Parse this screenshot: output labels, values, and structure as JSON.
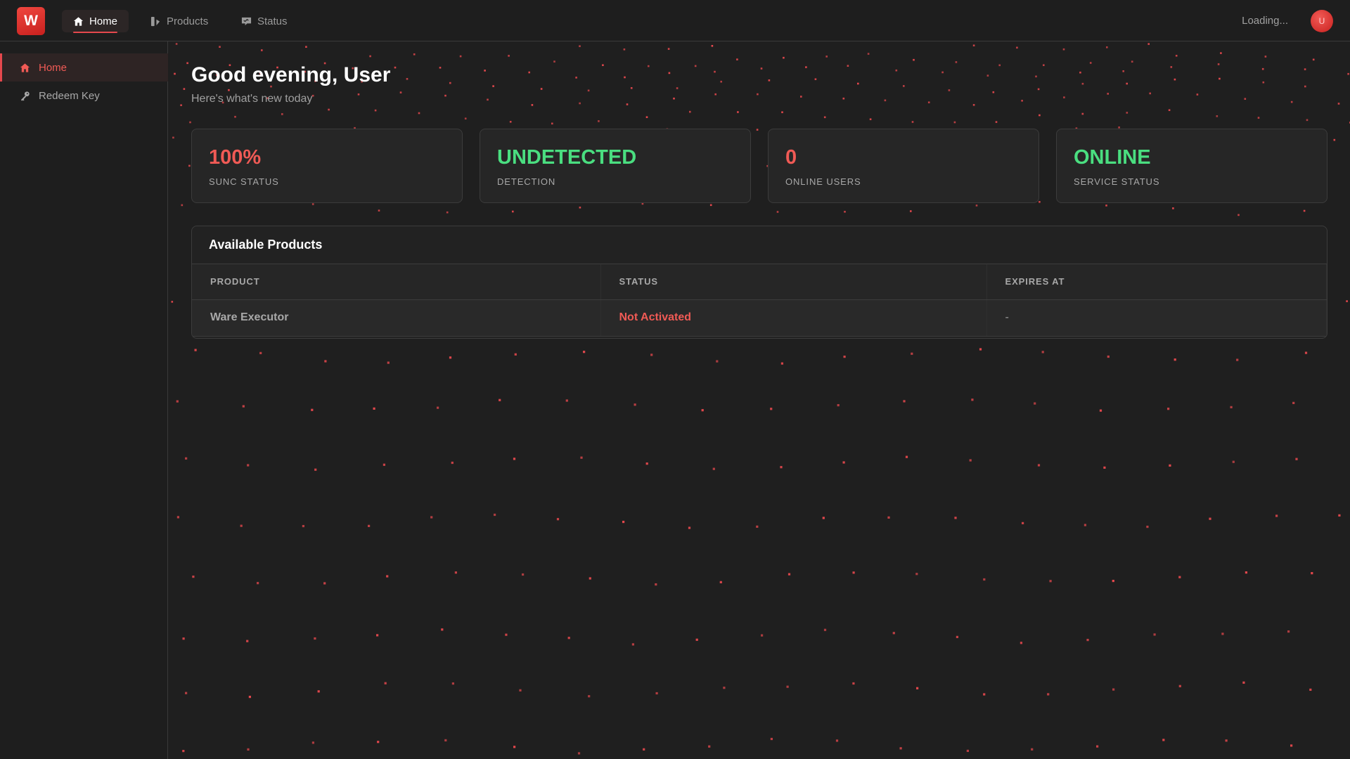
{
  "app": {
    "logo_letter": "W"
  },
  "topnav": {
    "tabs": [
      {
        "label": "Home",
        "icon": "home-icon",
        "active": true
      },
      {
        "label": "Products",
        "icon": "products-icon",
        "active": false
      },
      {
        "label": "Status",
        "icon": "status-icon",
        "active": false
      }
    ],
    "loading_text": "Loading...",
    "avatar_initial": "U"
  },
  "sidebar": {
    "items": [
      {
        "label": "Home",
        "icon": "home-icon",
        "active": true
      },
      {
        "label": "Redeem Key",
        "icon": "key-icon",
        "active": false
      }
    ]
  },
  "main": {
    "greeting": "Good evening, User",
    "subtitle": "Here's what's new today",
    "stats": [
      {
        "value": "100%",
        "label": "SUNC STATUS",
        "color": "#f05a55"
      },
      {
        "value": "UNDETECTED",
        "label": "DETECTION",
        "color": "#4ade80"
      },
      {
        "value": "0",
        "label": "ONLINE USERS",
        "color": "#f05a55"
      },
      {
        "value": "ONLINE",
        "label": "SERVICE STATUS",
        "color": "#4ade80"
      }
    ],
    "products": {
      "title": "Available Products",
      "columns": [
        "PRODUCT",
        "STATUS",
        "EXPIRES AT"
      ],
      "rows": [
        {
          "product": "Ware Executor",
          "status": "Not Activated",
          "expires": "-"
        }
      ]
    }
  },
  "colors": {
    "accent": "#e5484d",
    "success": "#4ade80",
    "background": "#1f1f1f",
    "dot": "#e5484d"
  }
}
